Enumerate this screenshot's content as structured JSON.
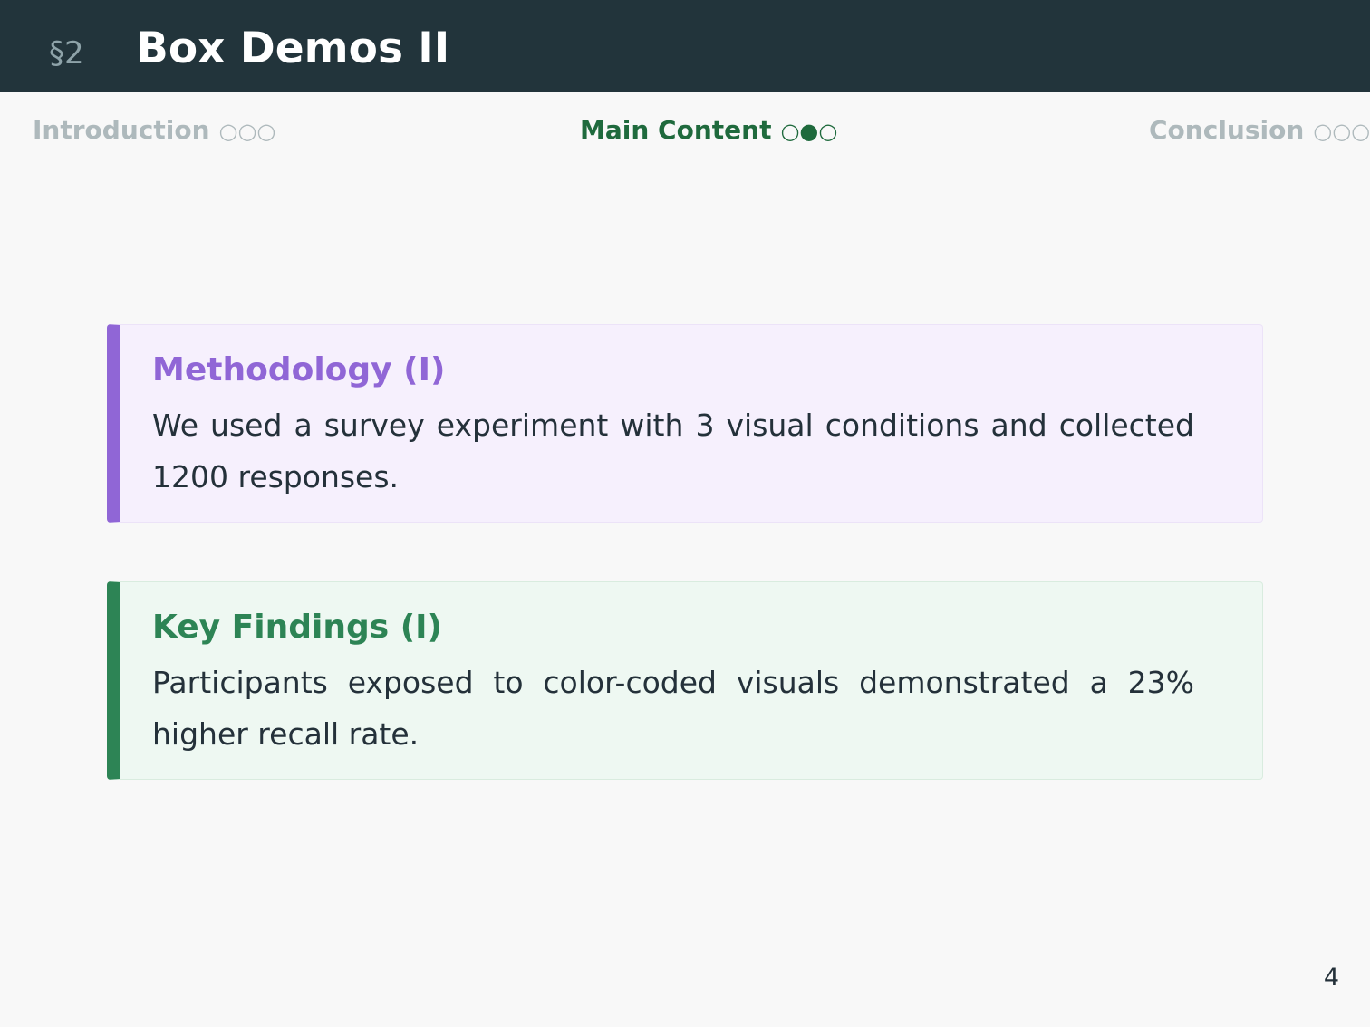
{
  "header": {
    "section_number": "§2",
    "title": "Box Demos II",
    "colors": {
      "background": "#22343b",
      "title": "#ffffff",
      "section_number": "#8ea3a9"
    }
  },
  "navigation": {
    "items": [
      {
        "label": "Introduction",
        "dots": "○○○",
        "active": false
      },
      {
        "label": "Main Content",
        "dots": "○●○",
        "active": true
      },
      {
        "label": "Conclusion",
        "dots": "○○○",
        "active": false
      }
    ],
    "colors": {
      "active": "#1f6a3d",
      "inactive": "#aeb9bc"
    }
  },
  "boxes": {
    "methodology": {
      "title": "Methodology (I)",
      "body": "We used a survey experiment with 3 visual conditions and collected 1200 responses.",
      "accent_color": "#9066d6",
      "background_color": "#f6f0fd"
    },
    "findings": {
      "title": "Key Findings (I)",
      "body": "Participants exposed to color-coded visuals demonstrated a 23% higher recall rate.",
      "accent_color": "#2d8455",
      "background_color": "#eef8f2"
    }
  },
  "footer": {
    "page_number": "4"
  }
}
